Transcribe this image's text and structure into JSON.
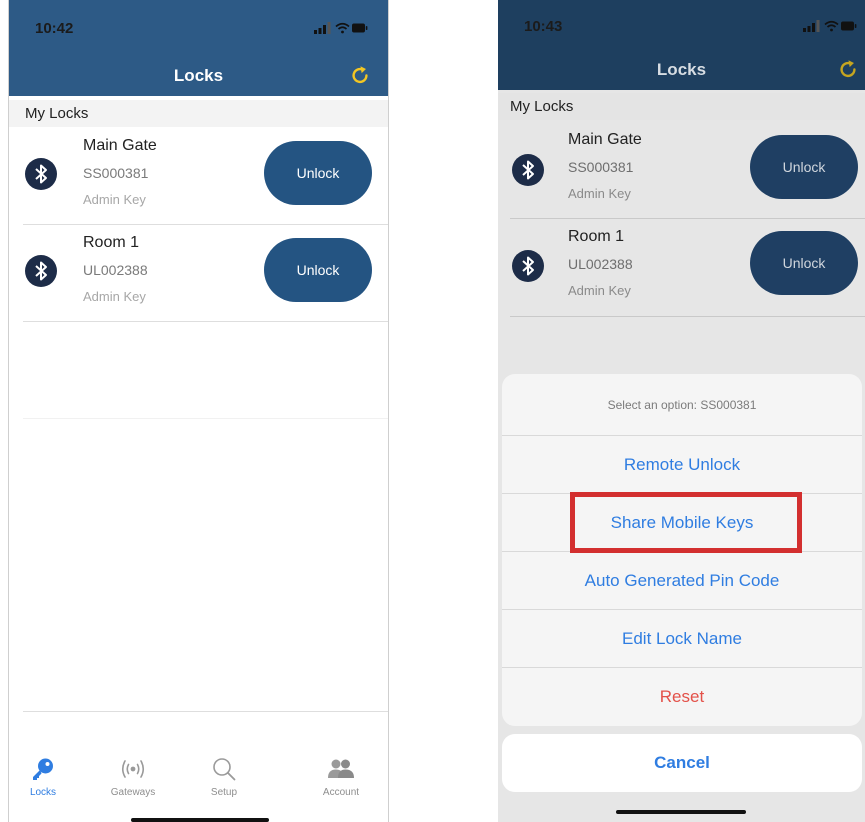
{
  "left_screen": {
    "time": "10:42",
    "title": "Locks",
    "section": "My Locks",
    "locks": [
      {
        "name": "Main Gate",
        "serial": "SS000381",
        "key_type": "Admin Key",
        "button": "Unlock"
      },
      {
        "name": "Room 1",
        "serial": "UL002388",
        "key_type": "Admin Key",
        "button": "Unlock"
      }
    ],
    "tabs": [
      {
        "label": "Locks",
        "icon": "key-icon"
      },
      {
        "label": "Gateways",
        "icon": "broadcast-icon"
      },
      {
        "label": "Setup",
        "icon": "search-icon"
      },
      {
        "label": "Account",
        "icon": "users-icon"
      }
    ]
  },
  "right_screen": {
    "time": "10:43",
    "title": "Locks",
    "section": "My Locks",
    "locks": [
      {
        "name": "Main Gate",
        "serial": "SS000381",
        "key_type": "Admin Key",
        "button": "Unlock"
      },
      {
        "name": "Room 1",
        "serial": "UL002388",
        "key_type": "Admin Key",
        "button": "Unlock"
      }
    ],
    "action_sheet": {
      "title": "Select an option: SS000381",
      "options": [
        "Remote Unlock",
        "Share Mobile Keys",
        "Auto Generated Pin Code",
        "Edit Lock Name",
        "Reset"
      ],
      "cancel": "Cancel",
      "highlighted_option": "Share Mobile Keys"
    }
  },
  "colors": {
    "nav": "#2d5a86",
    "button": "#245482",
    "accent": "#2f7de1",
    "destructive": "#e35149",
    "refresh": "#f3c623",
    "highlight": "#d32f2f"
  }
}
